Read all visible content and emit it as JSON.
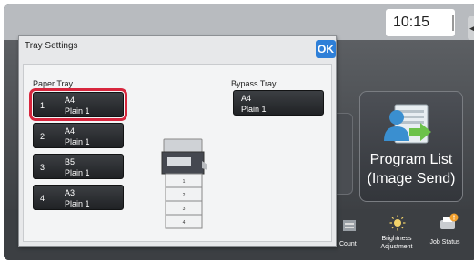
{
  "status_bar": {
    "clock": "10:15"
  },
  "home_screen": {
    "program_list_label": "Program List\n(Image Send)",
    "program_list_icon": "contacts-send-icon"
  },
  "bottom_bar": {
    "count_label": "Count",
    "brightness_label_line1": "Brightness",
    "brightness_label_line2": "Adjustment",
    "job_status_label": "Job Status",
    "count_icon": "counter-icon",
    "brightness_icon": "sun-icon",
    "job_status_icon": "printer-status-icon"
  },
  "dialog": {
    "title": "Tray Settings",
    "ok_label": "OK",
    "paper_tray_heading": "Paper Tray",
    "bypass_tray_heading": "Bypass Tray",
    "trays": [
      {
        "number": "1",
        "size": "A4",
        "type": "Plain 1",
        "highlighted": true
      },
      {
        "number": "2",
        "size": "A4",
        "type": "Plain 1",
        "highlighted": false
      },
      {
        "number": "3",
        "size": "B5",
        "type": "Plain 1",
        "highlighted": false
      },
      {
        "number": "4",
        "size": "A3",
        "type": "Plain 1",
        "highlighted": false
      }
    ],
    "bypass_tray": {
      "size": "A4",
      "type": "Plain 1"
    },
    "printer_drawer_numbers": [
      "1",
      "2",
      "3",
      "4"
    ],
    "printer_icon": "multifunction-printer-icon"
  },
  "colors": {
    "ok_button": "#2e7fd8",
    "highlight": "#d7263d",
    "tray_button": "#2a2c2f"
  }
}
